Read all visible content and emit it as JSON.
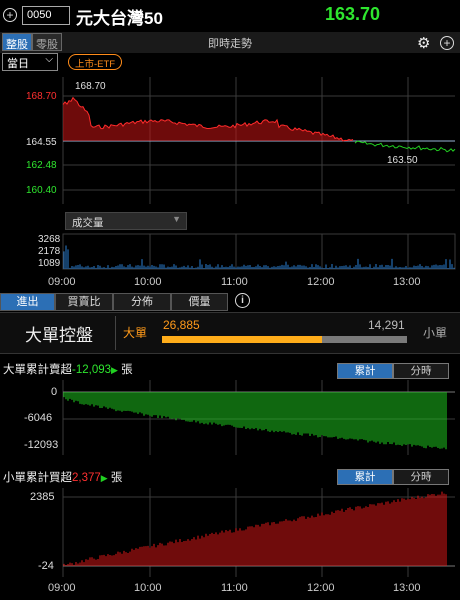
{
  "header": {
    "code": "0050",
    "name": "元大台灣50",
    "price": "163.70",
    "price_color": "#2ee62e"
  },
  "toolbar": {
    "tab_whole": "整股",
    "tab_odd": "零股",
    "title": "即時走勢",
    "period": "當日",
    "etf_badge": "上市-ETF"
  },
  "price_chart": {
    "y_labels": [
      "168.70",
      "164.55",
      "162.48",
      "160.40"
    ],
    "high_label": "168.70",
    "low_label": "163.50",
    "ref_price": 164.55,
    "colors": {
      "up": "#ff2b2b",
      "down": "#21d021",
      "ref": "#9ab3d6"
    }
  },
  "volume": {
    "selector": "成交量",
    "y_labels": [
      "3268",
      "2178",
      "1089"
    ]
  },
  "time_labels": [
    "09:00",
    "10:00",
    "11:00",
    "12:00",
    "13:00"
  ],
  "tabs": [
    "進出",
    "買賣比",
    "分佈",
    "價量"
  ],
  "control": {
    "title": "大單控盤",
    "big_label": "大單",
    "big_value": "26,885",
    "small_value": "14,291",
    "small_label": "小單",
    "big_ratio": 0.653
  },
  "big_chart": {
    "title_prefix": "大單累計賣超",
    "value": "-12,093",
    "unit": "張",
    "btn_total": "累計",
    "btn_period": "分時",
    "y_labels": [
      "0",
      "-6046",
      "-12093"
    ]
  },
  "small_chart": {
    "title_prefix": "小單累計買超",
    "value": "2,377",
    "unit": "張",
    "btn_total": "累計",
    "btn_period": "分時",
    "y_labels": [
      "2385",
      "-24"
    ]
  }
}
